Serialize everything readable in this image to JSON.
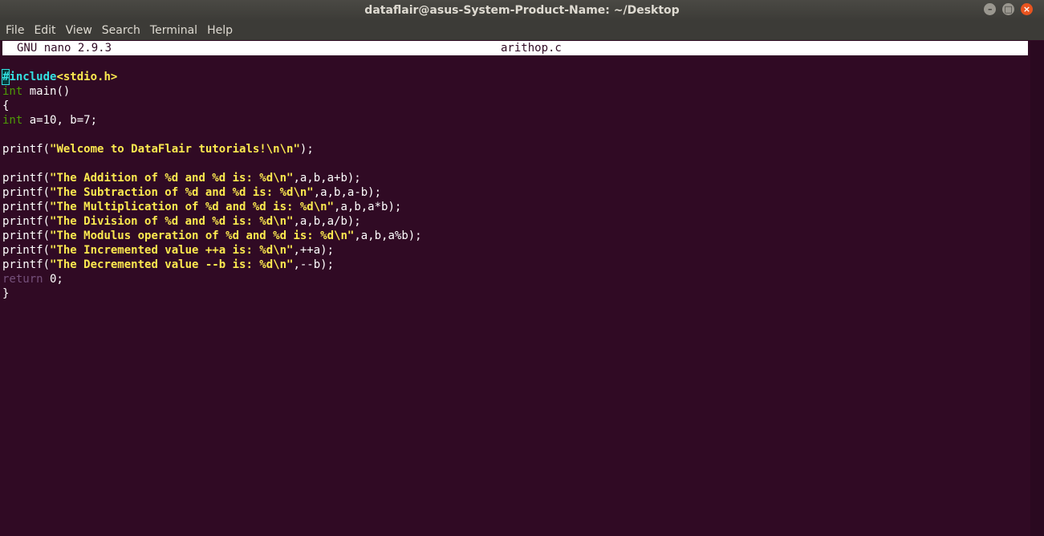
{
  "window": {
    "title": "dataflair@asus-System-Product-Name: ~/Desktop",
    "min_glyph": "–",
    "max_glyph": "□",
    "close_glyph": "×"
  },
  "menu": [
    "File",
    "Edit",
    "View",
    "Search",
    "Terminal",
    "Help"
  ],
  "nano": {
    "version": "GNU nano 2.9.3",
    "filename": "arithop.c"
  },
  "code": {
    "l1": {
      "a": "#",
      "b": "include",
      "c": "<stdio.h>"
    },
    "l2": {
      "a": "int",
      "b": " main()"
    },
    "l3": {
      "a": "{"
    },
    "l4": {
      "a": "int",
      "b": " a=10, b=7;"
    },
    "l5": {
      "a": ""
    },
    "l6": {
      "a": "printf(",
      "b": "\"Welcome to DataFlair tutorials!\\n\\n\"",
      "c": ");"
    },
    "l7": {
      "a": ""
    },
    "l8": {
      "a": "printf(",
      "b": "\"The Addition of %d and %d is: %d\\n\"",
      "c": ",a,b,a+b);"
    },
    "l9": {
      "a": "printf(",
      "b": "\"The Subtraction of %d and %d is: %d\\n\"",
      "c": ",a,b,a-b);"
    },
    "l10": {
      "a": "printf(",
      "b": "\"The Multiplication of %d and %d is: %d\\n\"",
      "c": ",a,b,a*b);"
    },
    "l11": {
      "a": "printf(",
      "b": "\"The Division of %d and %d is: %d\\n\"",
      "c": ",a,b,a/b);"
    },
    "l12": {
      "a": "printf(",
      "b": "\"The Modulus operation of %d and %d is: %d\\n\"",
      "c": ",a,b,a%b);"
    },
    "l13": {
      "a": "printf(",
      "b": "\"The Incremented value ++a is: %d\\n\"",
      "c": ",++a);"
    },
    "l14": {
      "a": "printf(",
      "b": "\"The Decremented value --b is: %d\\n\"",
      "c": ",--b);"
    },
    "l15": {
      "a": "return",
      "b": " 0;"
    },
    "l16": {
      "a": "}"
    }
  },
  "colors": {
    "background": "#300a24",
    "keyword": "#4e9a06",
    "string": "#fce94f",
    "preprocessor": "#34e2e2",
    "return": "#75507b"
  }
}
